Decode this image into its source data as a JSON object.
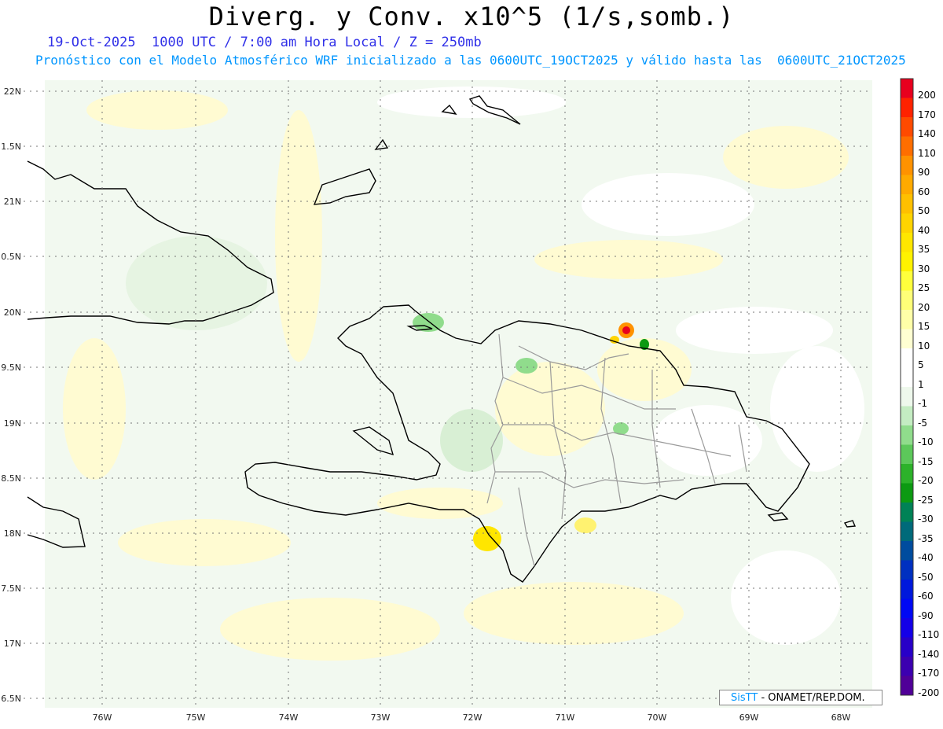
{
  "header": {
    "title": "Diverg. y Conv. x10^5 (1/s,somb.)",
    "date_line": "19-Oct-2025  1000 UTC / 7:00 am Hora Local / Z = 250mb",
    "model_line": "Pronóstico con el Modelo Atmosférico WRF inicializado a las 0600UTC_19OCT2025 y válido hasta las  0600UTC_21OCT2025"
  },
  "map": {
    "lat_ticks": [
      "22N",
      "1.5N",
      "21N",
      "0.5N",
      "20N",
      "9.5N",
      "19N",
      "8.5N",
      "18N",
      "7.5N",
      "17N",
      "6.5N"
    ],
    "lon_ticks": [
      "76W",
      "75W",
      "74W",
      "73W",
      "72W",
      "71W",
      "70W",
      "69W",
      "68W"
    ]
  },
  "colorbar": {
    "levels": [
      "200",
      "170",
      "140",
      "110",
      "90",
      "60",
      "50",
      "40",
      "35",
      "30",
      "25",
      "20",
      "15",
      "10",
      "5",
      "1",
      "-1",
      "-5",
      "-10",
      "-15",
      "-20",
      "-25",
      "-30",
      "-35",
      "-40",
      "-50",
      "-60",
      "-90",
      "-110",
      "-140",
      "-170",
      "-200"
    ],
    "colors": [
      "#e8001e",
      "#ff2200",
      "#ff4a00",
      "#ff6e00",
      "#ff9200",
      "#ffaa00",
      "#ffc000",
      "#ffd400",
      "#ffe600",
      "#fff200",
      "#ffff3c",
      "#ffff78",
      "#ffffa8",
      "#ffffd2",
      "#ffffff",
      "#ffffff",
      "#eef8ec",
      "#c4ecc2",
      "#90dc8c",
      "#5cc85a",
      "#2cb22a",
      "#0c9a12",
      "#008256",
      "#006a7a",
      "#004c9e",
      "#0030c0",
      "#0018dc",
      "#0008f4",
      "#1400e8",
      "#2800c8",
      "#3c00b0",
      "#500098"
    ]
  },
  "credit": {
    "brand": "SisTT",
    "text": "- ONAMET/REP.DOM."
  }
}
